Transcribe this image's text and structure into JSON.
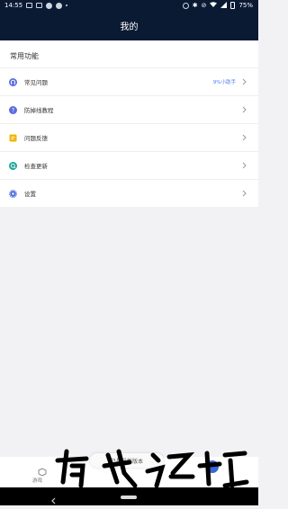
{
  "status_bar": {
    "time": "14:55",
    "battery": "75%"
  },
  "header": {
    "title": "我的"
  },
  "section": {
    "title": "常用功能",
    "items": [
      {
        "label": "常见问题",
        "badge": "9%小助手",
        "icon": "headset-icon",
        "icon_color": "#5b6ee0"
      },
      {
        "label": "防掉线教程",
        "badge": "",
        "icon": "question-circle-icon",
        "icon_color": "#5b6ee0"
      },
      {
        "label": "问题反馈",
        "badge": "",
        "icon": "feedback-icon",
        "icon_color": "#f4b400"
      },
      {
        "label": "检查更新",
        "badge": "",
        "icon": "update-icon",
        "icon_color": "#1aa59a"
      },
      {
        "label": "设置",
        "badge": "",
        "icon": "gear-icon",
        "icon_color": "#4a6ee0"
      }
    ]
  },
  "bottom": {
    "toast": "已是最新版本",
    "tab_label": "游戏"
  },
  "colors": {
    "header_bg": "#0b1a33",
    "accent": "#4a7bf2"
  }
}
